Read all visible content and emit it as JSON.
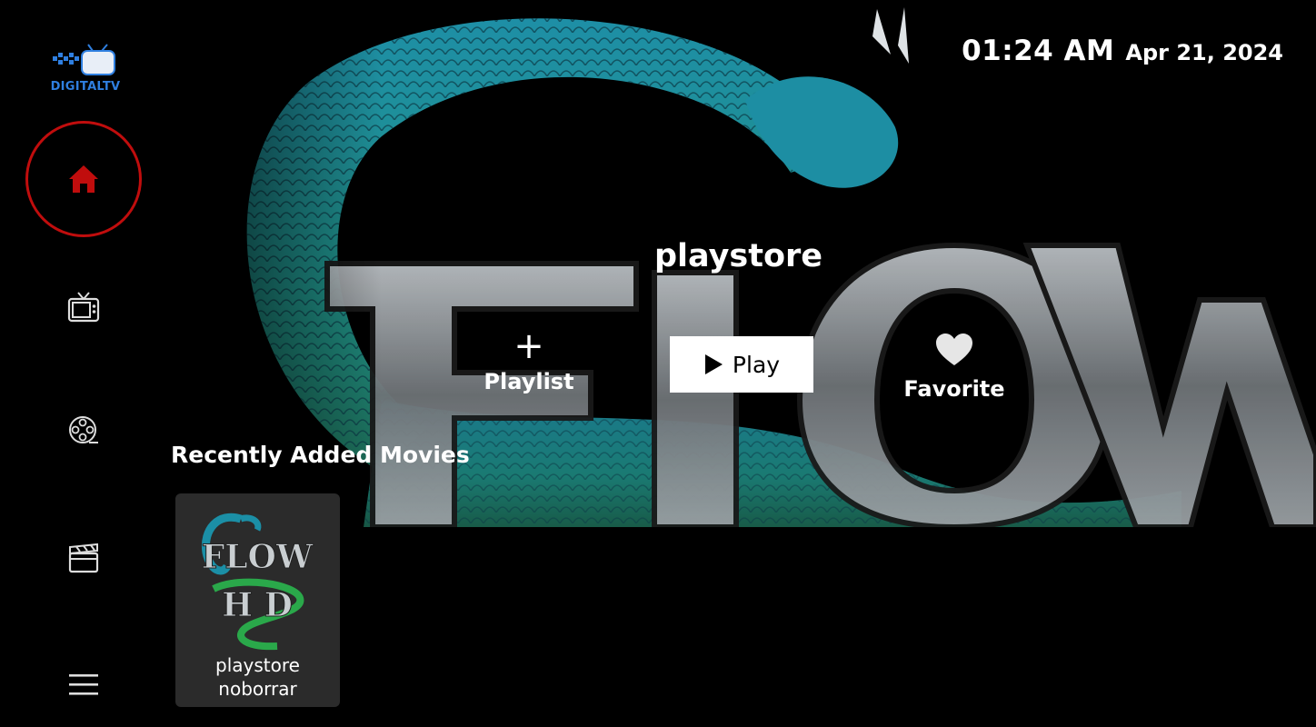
{
  "app": {
    "logo_text": "DIGITALTV"
  },
  "clock": {
    "time": "01:24 AM",
    "date": "Apr 21, 2024"
  },
  "featured": {
    "title": "playstore",
    "actions": {
      "playlist": "Playlist",
      "play": "Play",
      "favorite": "Favorite"
    }
  },
  "sidebar": {
    "items": [
      {
        "icon": "home-icon",
        "active": true
      },
      {
        "icon": "tv-icon",
        "active": false
      },
      {
        "icon": "film-reel-icon",
        "active": false
      },
      {
        "icon": "clapperboard-icon",
        "active": false
      },
      {
        "icon": "menu-icon",
        "active": false
      }
    ]
  },
  "recent": {
    "title": "Recently Added Movies",
    "movies": [
      {
        "name": "playstore noborrar",
        "poster_text": "FLOW HD"
      }
    ]
  },
  "colors": {
    "accent": "#c00d0d",
    "background": "#000000",
    "card": "#2b2b2b"
  }
}
